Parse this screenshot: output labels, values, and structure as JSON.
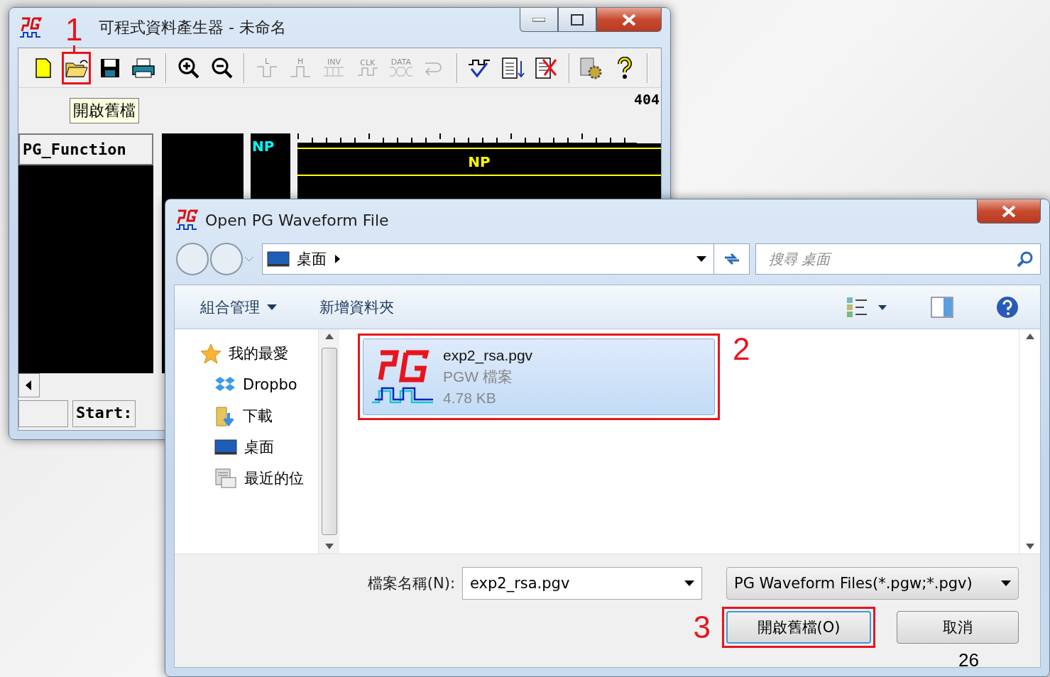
{
  "main_window": {
    "title": "可程式資料產生器 - 未命名",
    "toolbar": [
      {
        "kind": "new",
        "disabled": false
      },
      {
        "kind": "open",
        "disabled": false,
        "highlighted": true
      },
      {
        "kind": "save",
        "disabled": false
      },
      {
        "kind": "print",
        "disabled": false
      },
      {
        "kind": "separator"
      },
      {
        "kind": "zoom-in",
        "disabled": false
      },
      {
        "kind": "zoom-out",
        "disabled": false
      },
      {
        "kind": "separator"
      },
      {
        "kind": "low",
        "label": "L",
        "disabled": true
      },
      {
        "kind": "high",
        "label": "H",
        "disabled": true
      },
      {
        "kind": "invert",
        "label": "INV",
        "disabled": true
      },
      {
        "kind": "clock",
        "label": "CLK",
        "disabled": true
      },
      {
        "kind": "data",
        "label": "DATA",
        "disabled": true
      },
      {
        "kind": "undo",
        "disabled": true
      },
      {
        "kind": "separator"
      },
      {
        "kind": "check",
        "disabled": false
      },
      {
        "kind": "list-down",
        "disabled": false
      },
      {
        "kind": "list-delete",
        "disabled": false
      },
      {
        "kind": "separator"
      },
      {
        "kind": "settings",
        "disabled": false
      },
      {
        "kind": "help",
        "disabled": false
      },
      {
        "kind": "separator"
      }
    ],
    "tooltip": "開啟舊檔",
    "counter": "404",
    "function_label": "PG_Function",
    "column_label": "NP",
    "waveform_label": "NP",
    "status_label": "Start:"
  },
  "dialog": {
    "title": "Open PG Waveform File",
    "breadcrumb": "桌面",
    "search": {
      "placeholder": "搜尋 桌面"
    },
    "commands": [
      {
        "label": "組合管理",
        "dropdown": true
      },
      {
        "label": "新增資料夾",
        "dropdown": false
      }
    ],
    "nav_items": [
      {
        "kind": "favorites",
        "label": "我的最愛",
        "child": false
      },
      {
        "kind": "dropbox",
        "label": "Dropbo",
        "child": true
      },
      {
        "kind": "downloads",
        "label": "下載",
        "child": true
      },
      {
        "kind": "desktop",
        "label": "桌面",
        "child": true
      },
      {
        "kind": "recent",
        "label": "最近的位",
        "child": true
      }
    ],
    "files": [
      {
        "name": "exp2_rsa.pgv",
        "type": "PGW 檔案",
        "size": "4.78 KB",
        "selected": true
      }
    ],
    "filename_label": "檔案名稱(N):",
    "filename_value": "exp2_rsa.pgv",
    "filter": "PG Waveform Files(*.pgw;*.pgv)",
    "buttons": [
      {
        "label": "開啟舊檔(O)",
        "highlighted": true
      },
      {
        "label": "取消",
        "highlighted": false
      }
    ]
  },
  "annotations": [
    {
      "kind": "step",
      "text": "1"
    },
    {
      "kind": "step",
      "text": "2"
    },
    {
      "kind": "step",
      "text": "3"
    },
    {
      "kind": "page",
      "text": "26"
    }
  ]
}
